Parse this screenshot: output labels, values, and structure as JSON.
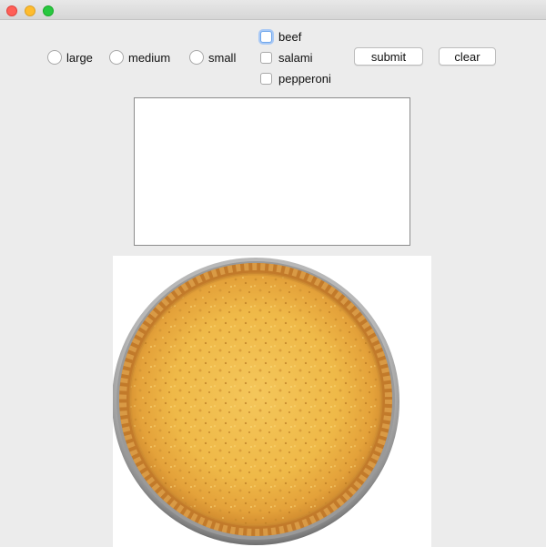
{
  "window": {
    "controls": [
      "close",
      "minimize",
      "zoom"
    ]
  },
  "size_options": [
    {
      "label": "large"
    },
    {
      "label": "medium"
    },
    {
      "label": "small"
    }
  ],
  "toppings": [
    {
      "label": "beef",
      "checked": false,
      "focused": true
    },
    {
      "label": "salami",
      "checked": false
    },
    {
      "label": "pepperoni",
      "checked": false
    }
  ],
  "actions": {
    "submit_label": "submit",
    "clear_label": "clear"
  },
  "output_area": {
    "value": ""
  },
  "image": {
    "subject": "pizza-crust-image"
  }
}
